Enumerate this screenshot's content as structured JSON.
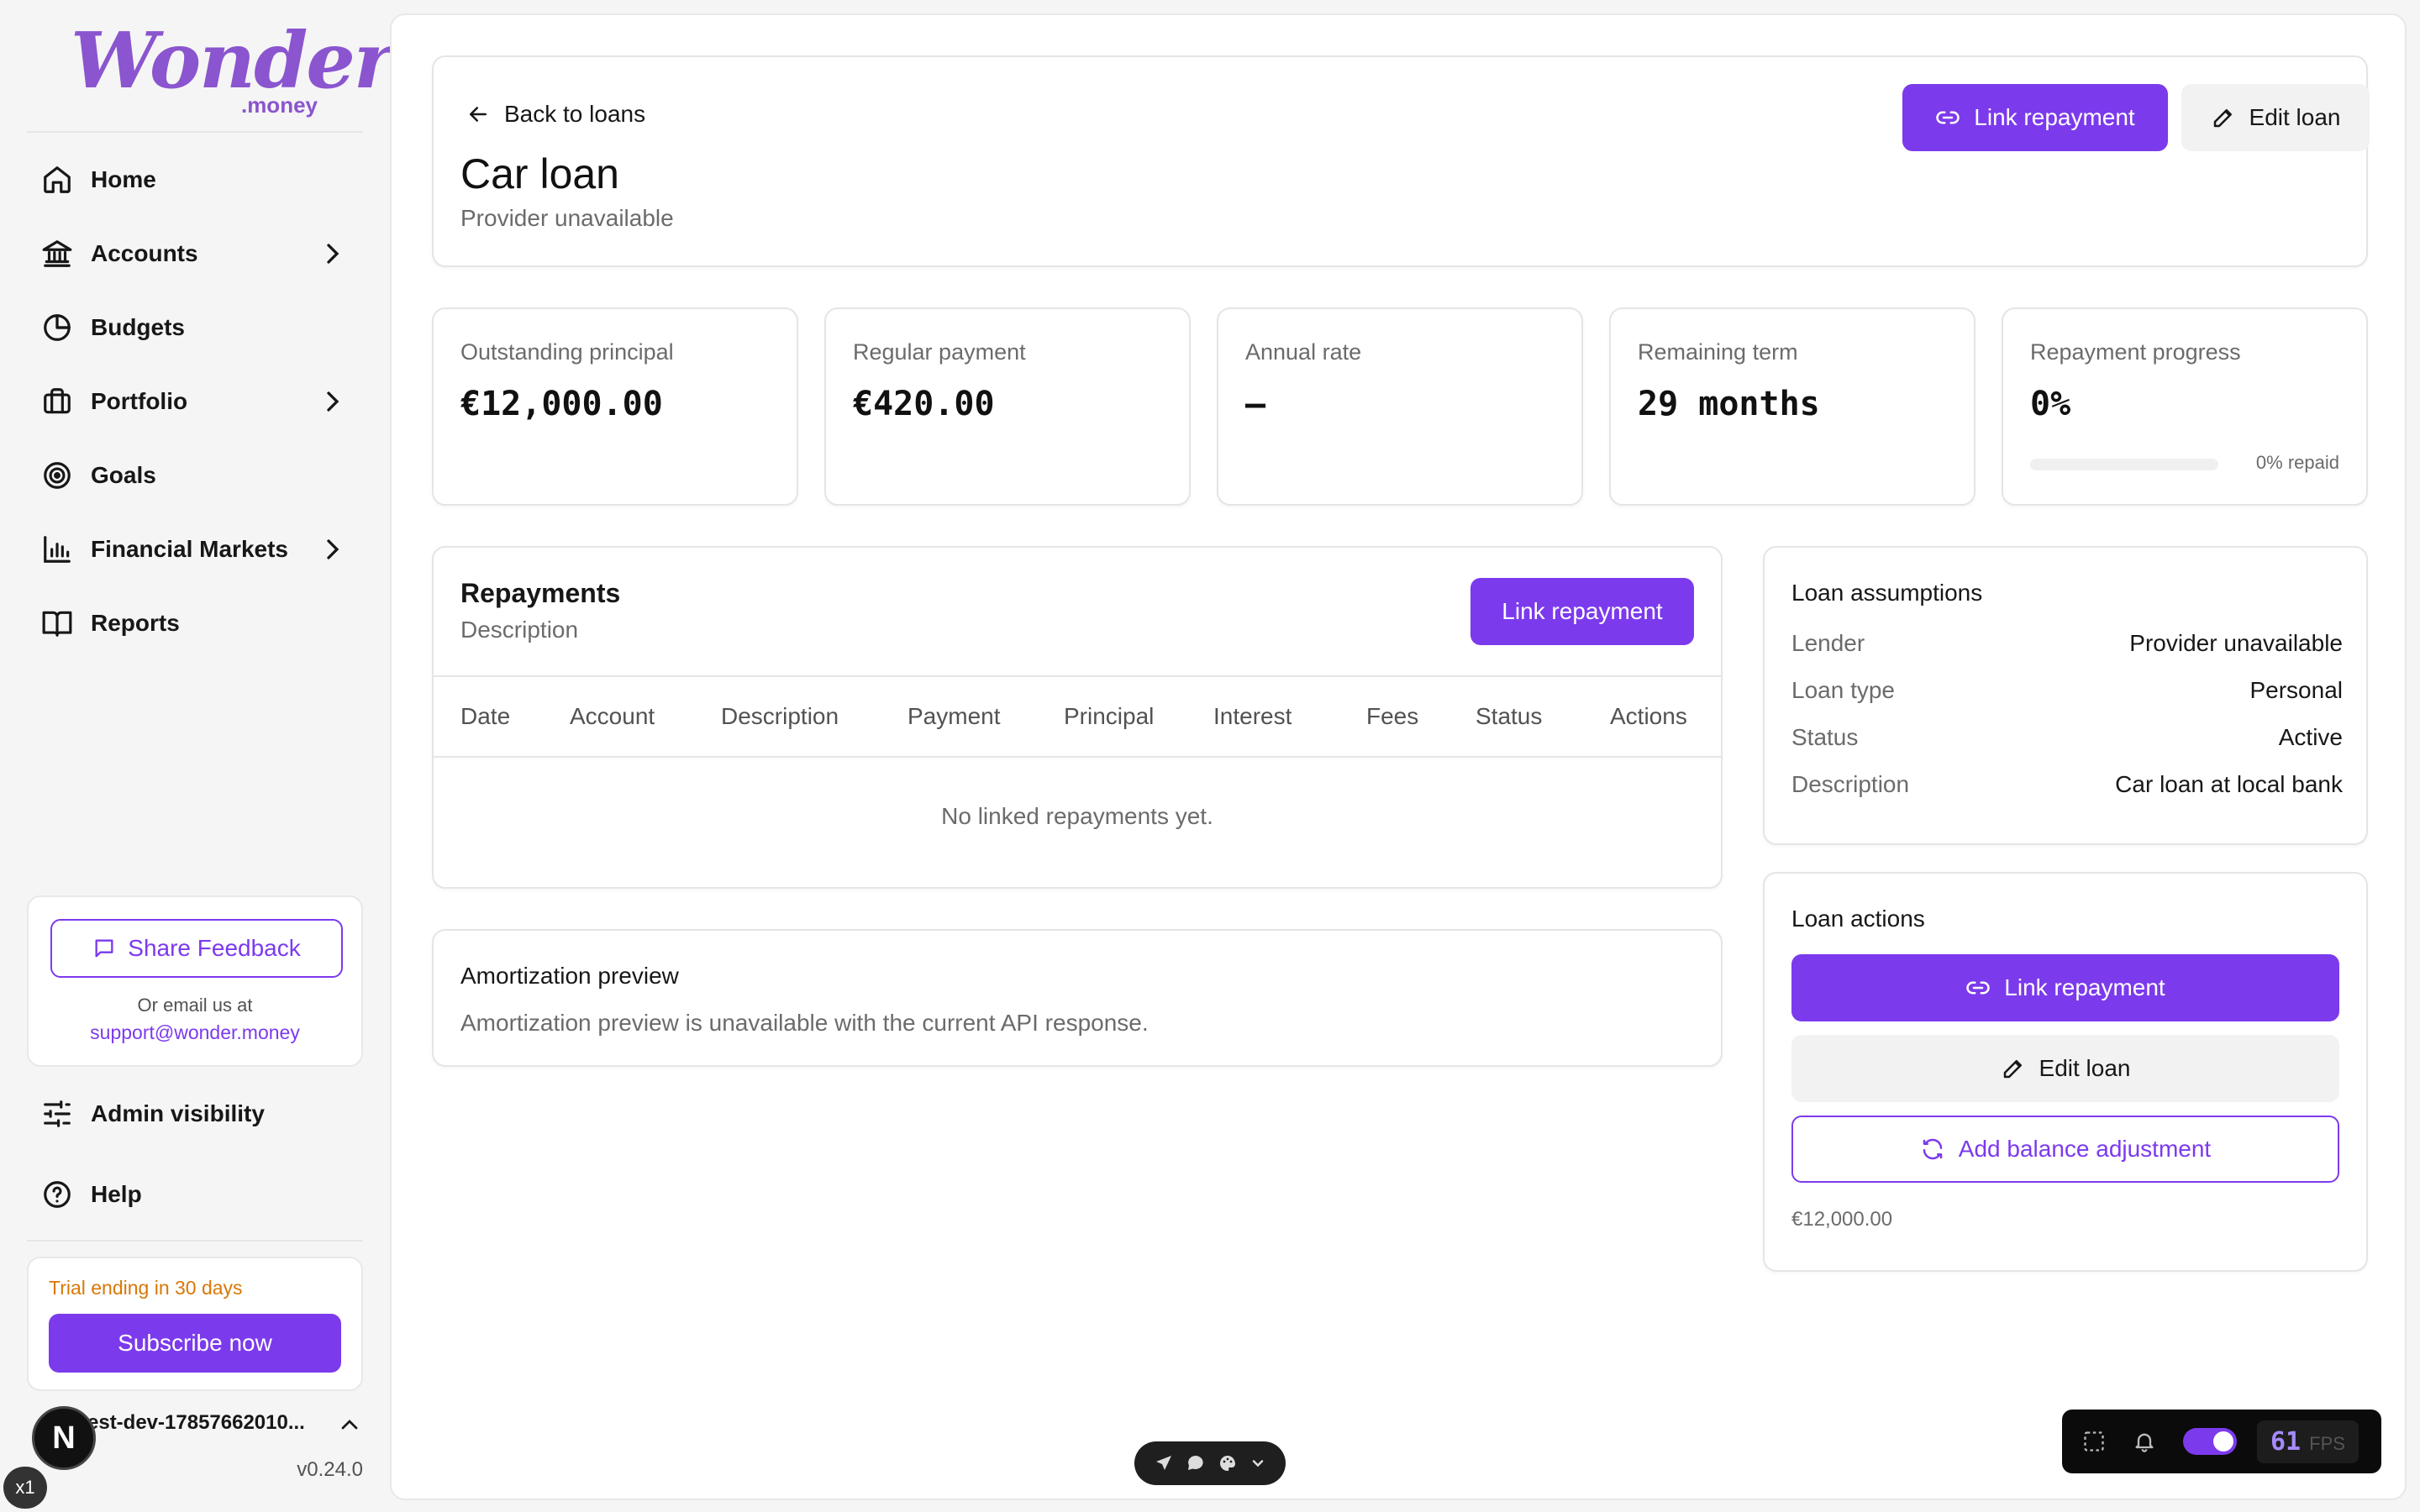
{
  "brand": {
    "name": "Wonder",
    "suffix": ".money",
    "accent": "#7c3aed"
  },
  "sidebar": {
    "items": [
      {
        "label": "Home",
        "icon": "home-icon",
        "has_chevron": false
      },
      {
        "label": "Accounts",
        "icon": "bank-icon",
        "has_chevron": true
      },
      {
        "label": "Budgets",
        "icon": "pie-chart-icon",
        "has_chevron": false
      },
      {
        "label": "Portfolio",
        "icon": "briefcase-icon",
        "has_chevron": true
      },
      {
        "label": "Goals",
        "icon": "target-icon",
        "has_chevron": false
      },
      {
        "label": "Financial Markets",
        "icon": "bar-chart-icon",
        "has_chevron": true
      },
      {
        "label": "Reports",
        "icon": "book-icon",
        "has_chevron": false
      }
    ],
    "feedback": {
      "button_label": "Share Feedback",
      "note": "Or email us at",
      "email": "support@wonder.money"
    },
    "admin_label": "Admin visibility",
    "help_label": "Help",
    "trial": {
      "text": "Trial ending in 30 days",
      "button_label": "Subscribe now"
    },
    "user": {
      "name": "test-dev-17857662010..."
    },
    "version": "v0.24.0",
    "dev_badge": "N",
    "zoom_badge": "x1"
  },
  "header": {
    "back_label": "Back to loans",
    "title": "Car loan",
    "subtitle": "Provider unavailable",
    "link_repayment_label": "Link repayment",
    "edit_loan_label": "Edit loan"
  },
  "stats": [
    {
      "label": "Outstanding principal",
      "value": "€12,000.00"
    },
    {
      "label": "Regular payment",
      "value": "€420.00"
    },
    {
      "label": "Annual rate",
      "value": "–"
    },
    {
      "label": "Remaining term",
      "value": "29 months"
    },
    {
      "label": "Repayment progress",
      "value": "0%",
      "progress_fraction": 0,
      "note": "0% repaid"
    }
  ],
  "repayments": {
    "title": "Repayments",
    "subtitle": "Description",
    "button_label": "Link repayment",
    "columns": [
      "Date",
      "Account",
      "Description",
      "Payment",
      "Principal",
      "Interest",
      "Fees",
      "Status",
      "Actions"
    ],
    "empty_text": "No linked repayments yet."
  },
  "amortization": {
    "title": "Amortization preview",
    "text": "Amortization preview is unavailable with the current API response."
  },
  "assumptions": {
    "title": "Loan assumptions",
    "rows": [
      {
        "key": "Lender",
        "value": "Provider unavailable"
      },
      {
        "key": "Loan type",
        "value": "Personal"
      },
      {
        "key": "Status",
        "value": "Active"
      },
      {
        "key": "Description",
        "value": "Car loan at local bank"
      }
    ]
  },
  "actions": {
    "title": "Loan actions",
    "link_repayment_label": "Link repayment",
    "edit_loan_label": "Edit loan",
    "balance_adjustment_label": "Add balance adjustment",
    "balance_note": "€12,000.00"
  },
  "perf": {
    "fps": "61",
    "fps_label": "FPS"
  }
}
